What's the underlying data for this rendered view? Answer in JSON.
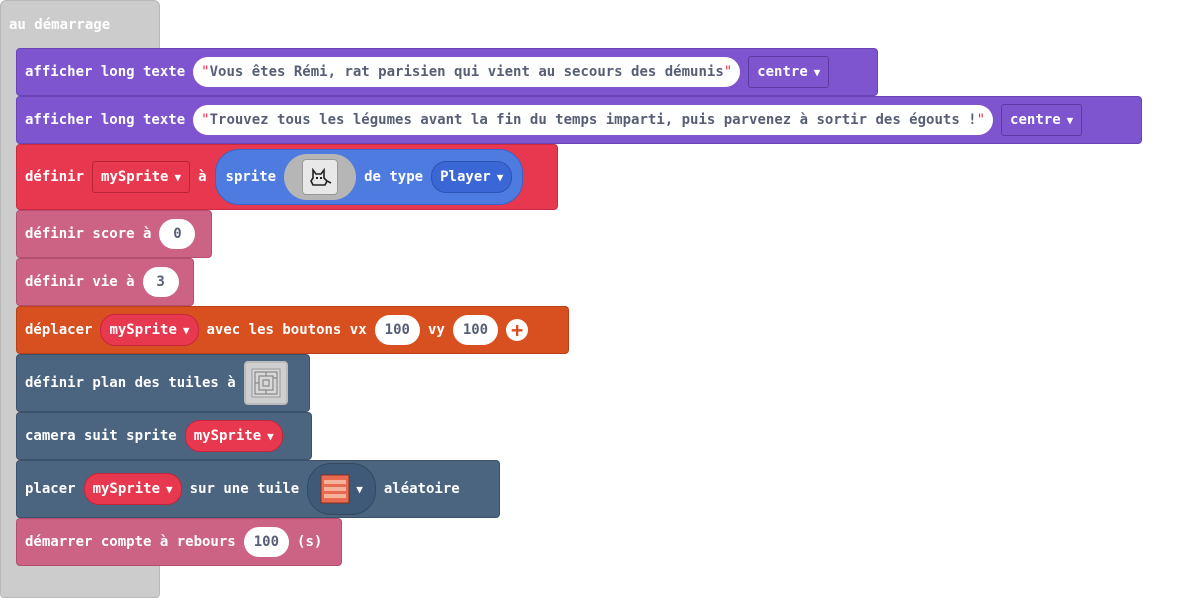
{
  "hat": {
    "label": "au démarrage"
  },
  "blocks": [
    {
      "words": [
        "afficher long texte"
      ],
      "string": "Vous êtes Rémi, rat parisien qui vient au secours des démunis",
      "align": "centre"
    },
    {
      "words": [
        "afficher long texte"
      ],
      "string": "Trouvez tous les légumes avant la fin du temps imparti, puis parvenez à sortir des égouts !",
      "align": "centre"
    },
    {
      "label1": "définir",
      "var": "mySprite",
      "label2": "à",
      "sprite_label": "sprite",
      "type_label": "de type",
      "type_value": "Player"
    },
    {
      "label": "définir score à",
      "value": "0"
    },
    {
      "label": "définir vie à",
      "value": "3"
    },
    {
      "label1": "déplacer",
      "var": "mySprite",
      "label2": "avec les boutons vx",
      "vx": "100",
      "label3": "vy",
      "vy": "100"
    },
    {
      "label": "définir plan des tuiles à"
    },
    {
      "label": "camera suit sprite",
      "var": "mySprite"
    },
    {
      "label1": "placer",
      "var": "mySprite",
      "label2": "sur une tuile",
      "label3": "aléatoire"
    },
    {
      "label": "démarrer compte à rebours",
      "value": "100",
      "unit": "(s)"
    }
  ],
  "colors": {
    "hat": "#cccccc",
    "looks": "#7f55cf",
    "sprites": "#e8384f",
    "info": "#cc6384",
    "controller": "#d8501f",
    "scene": "#4b6480"
  },
  "quote_char": "\""
}
